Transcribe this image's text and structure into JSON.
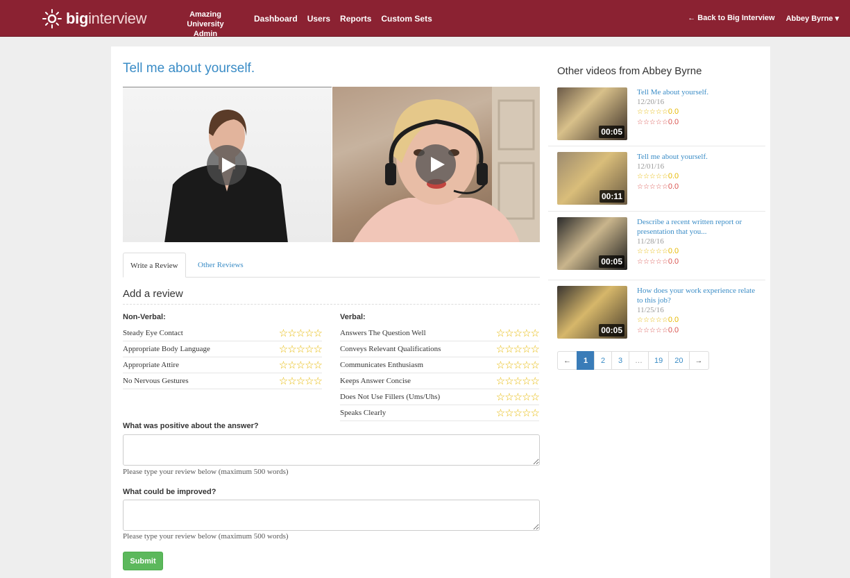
{
  "topbar": {
    "logo_bold": "big",
    "logo_light": "interview",
    "org_line1": "Amazing University",
    "org_line2": "Admin",
    "nav": [
      "Dashboard",
      "Users",
      "Reports",
      "Custom Sets"
    ],
    "back_link": "← Back to Big Interview",
    "user_menu": "Abbey Byrne ▾"
  },
  "question": {
    "title": "Tell me about yourself."
  },
  "tabs": {
    "write": "Write a Review",
    "other": "Other Reviews"
  },
  "review": {
    "heading": "Add a review",
    "nonverbal": {
      "heading": "Non-Verbal:",
      "items": [
        "Steady Eye Contact",
        "Appropriate Body Language",
        "Appropriate Attire",
        "No Nervous Gestures"
      ]
    },
    "verbal": {
      "heading": "Verbal:",
      "items": [
        "Answers The Question Well",
        "Conveys Relevant Qualifications",
        "Communicates Enthusiasm",
        "Keeps Answer Concise",
        "Does Not Use Fillers (Ums/Uhs)",
        "Speaks Clearly"
      ]
    },
    "stars_glyph": "☆☆☆☆☆",
    "positive_label": "What was positive about the answer?",
    "improve_label": "What could be improved?",
    "hint": "Please type your review below (maximum 500 words)",
    "submit": "Submit"
  },
  "sidebar": {
    "title": "Other videos from Abbey Byrne",
    "videos": [
      {
        "title": "Tell Me about yourself.",
        "date": "12/20/16",
        "duration": "00:05",
        "rating1": "0.0",
        "rating2": "0.0"
      },
      {
        "title": "Tell me about yourself.",
        "date": "12/01/16",
        "duration": "00:11",
        "rating1": "0.0",
        "rating2": "0.0"
      },
      {
        "title": "Describe a recent written report or presentation that you...",
        "date": "11/28/16",
        "duration": "00:05",
        "rating1": "0.0",
        "rating2": "0.0"
      },
      {
        "title": "How does your work experience relate to this job?",
        "date": "11/25/16",
        "duration": "00:05",
        "rating1": "0.0",
        "rating2": "0.0"
      }
    ],
    "small_stars": "☆☆☆☆☆",
    "pagination": [
      "←",
      "1",
      "2",
      "3",
      "…",
      "19",
      "20",
      "→"
    ],
    "current_page": "1"
  },
  "colors": {
    "topbar": "#8b2232",
    "link": "#3a8cc6",
    "star": "#e6b800",
    "star_alt": "#d9534f",
    "submit": "#5cb85c",
    "page_active": "#3a7cb8"
  }
}
